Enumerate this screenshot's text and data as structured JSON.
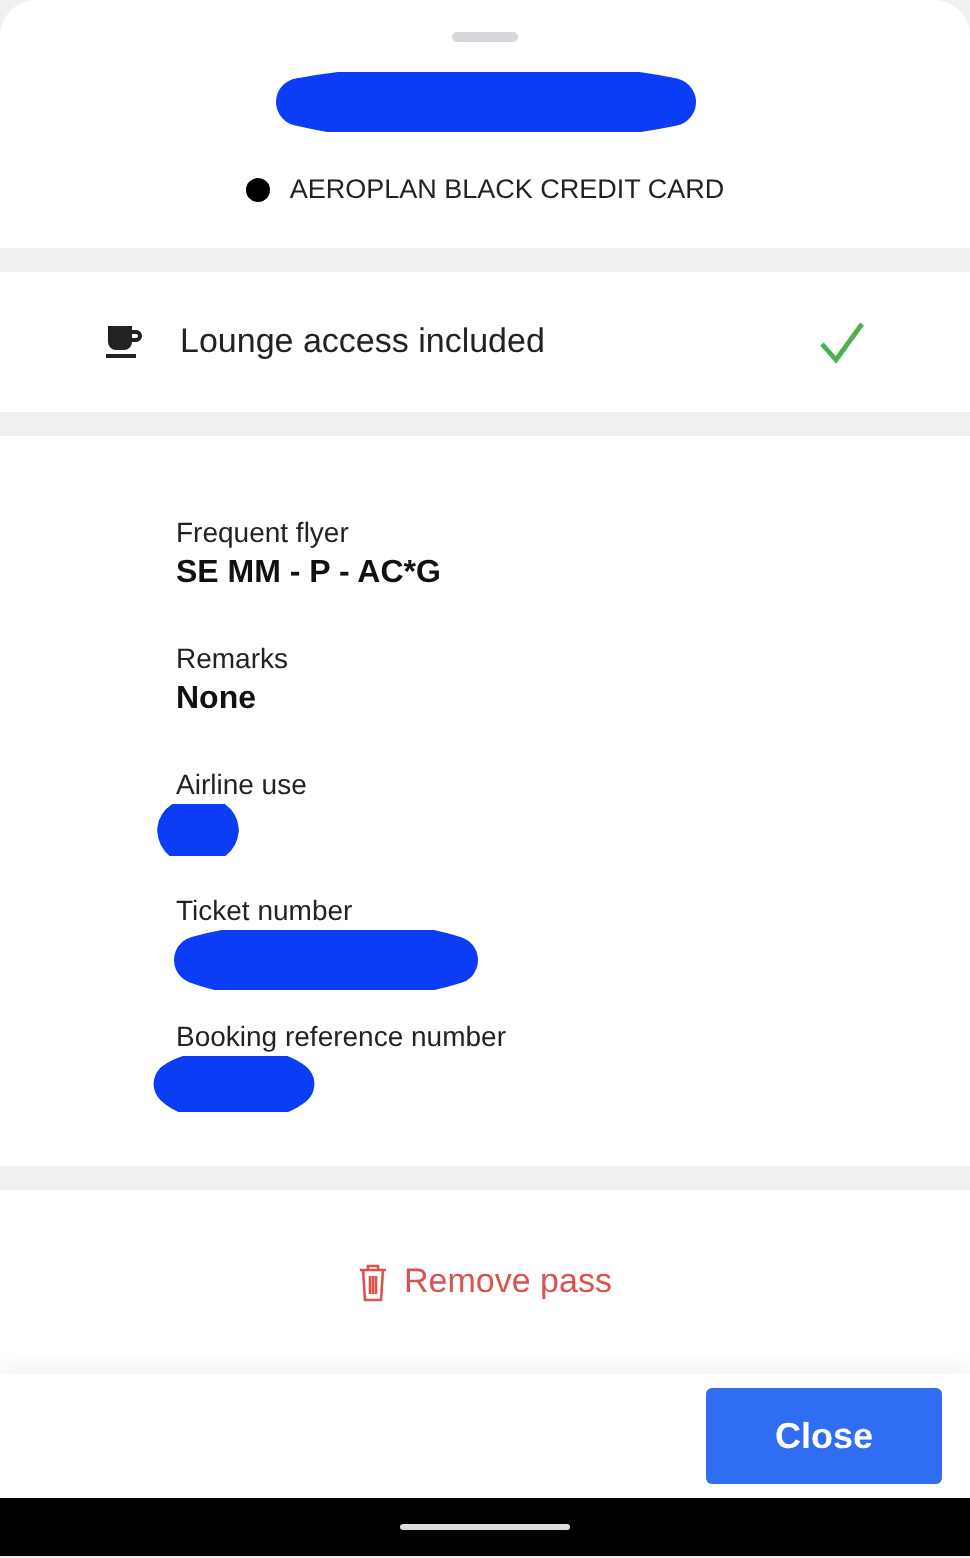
{
  "header": {
    "title_redacted": true,
    "card": {
      "name": "AEROPLAN BLACK CREDIT CARD",
      "color": "#000000"
    }
  },
  "benefit": {
    "label": "Lounge access included",
    "included": true
  },
  "fields": [
    {
      "label": "Frequent flyer",
      "value": "SE MM - P - AC*G",
      "redacted": false
    },
    {
      "label": "Remarks",
      "value": "None",
      "redacted": false
    },
    {
      "label": "Airline use",
      "redacted": true
    },
    {
      "label": "Ticket number",
      "redacted": true
    },
    {
      "label": "Booking reference number",
      "redacted": true
    }
  ],
  "remove_button": {
    "label": "Remove pass"
  },
  "close_button": {
    "label": "Close"
  }
}
